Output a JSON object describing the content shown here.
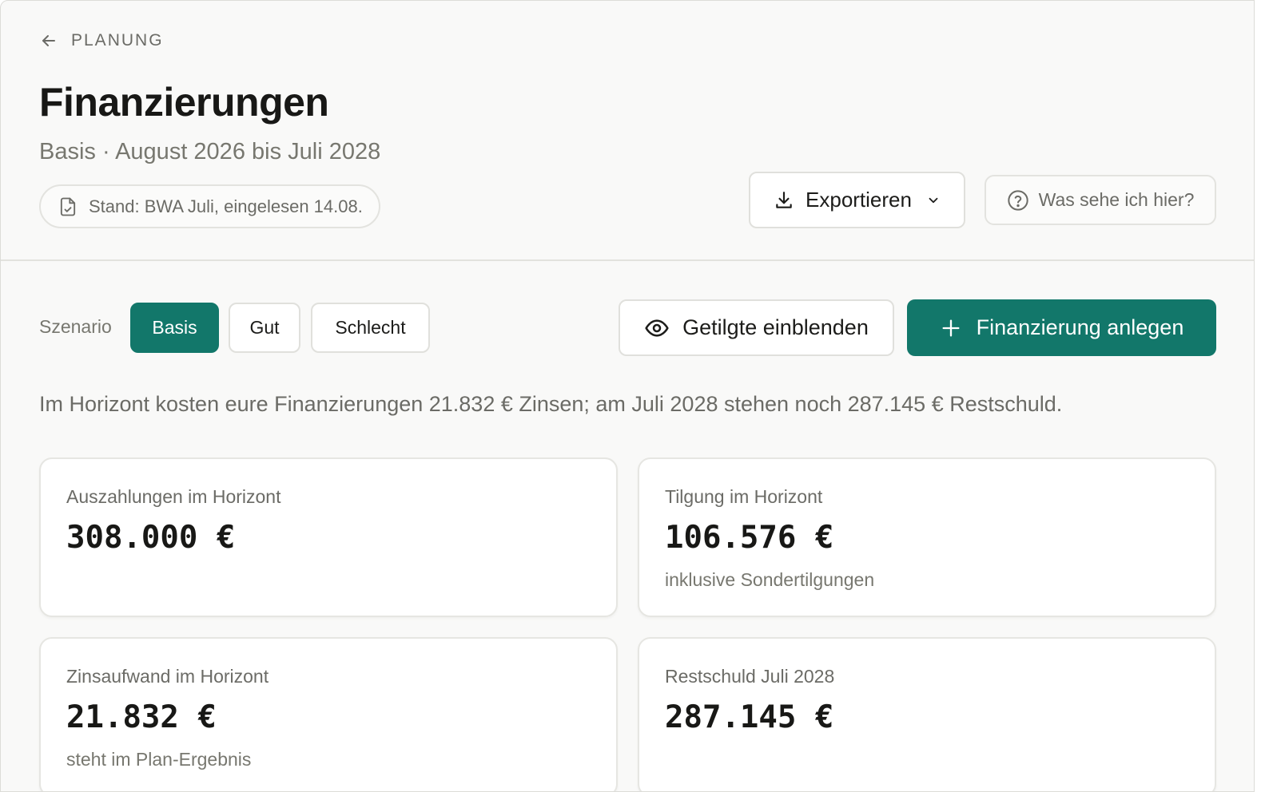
{
  "nav": {
    "back_label": "PLANUNG"
  },
  "header": {
    "title": "Finanzierungen",
    "subtitle": "Basis · August 2026 bis Juli 2028",
    "stand": "Stand: BWA Juli, eingelesen 14.08.",
    "export_label": "Exportieren",
    "help_label": "Was sehe ich hier?"
  },
  "toolbar": {
    "scenario_label": "Szenario",
    "scenarios": [
      {
        "label": "Basis",
        "active": true
      },
      {
        "label": "Gut",
        "active": false
      },
      {
        "label": "Schlecht",
        "active": false
      }
    ],
    "show_repaid_label": "Getilgte einblenden",
    "add_label": "Finanzierung anlegen"
  },
  "summary": "Im Horizont kosten eure Finanzierungen 21.832 € Zinsen; am Juli 2028 stehen noch 287.145 € Restschuld.",
  "cards": [
    {
      "label": "Auszahlungen im Horizont",
      "value": "308.000 €",
      "note": ""
    },
    {
      "label": "Tilgung im Horizont",
      "value": "106.576 €",
      "note": "inklusive Sondertilgungen"
    },
    {
      "label": "Zinsaufwand im Horizont",
      "value": "21.832 €",
      "note": "steht im Plan-Ergebnis"
    },
    {
      "label": "Restschuld Juli 2028",
      "value": "287.145 €",
      "note": ""
    }
  ],
  "colors": {
    "accent": "#12776a",
    "background": "#f9f9f8",
    "border": "#e0e0dc"
  },
  "icons": {
    "back": "arrow-left-icon",
    "stand": "file-check-icon",
    "export": "download-icon",
    "export_menu": "chevron-down-icon",
    "help": "help-circle-icon",
    "show_repaid": "eye-icon",
    "add": "plus-icon"
  }
}
